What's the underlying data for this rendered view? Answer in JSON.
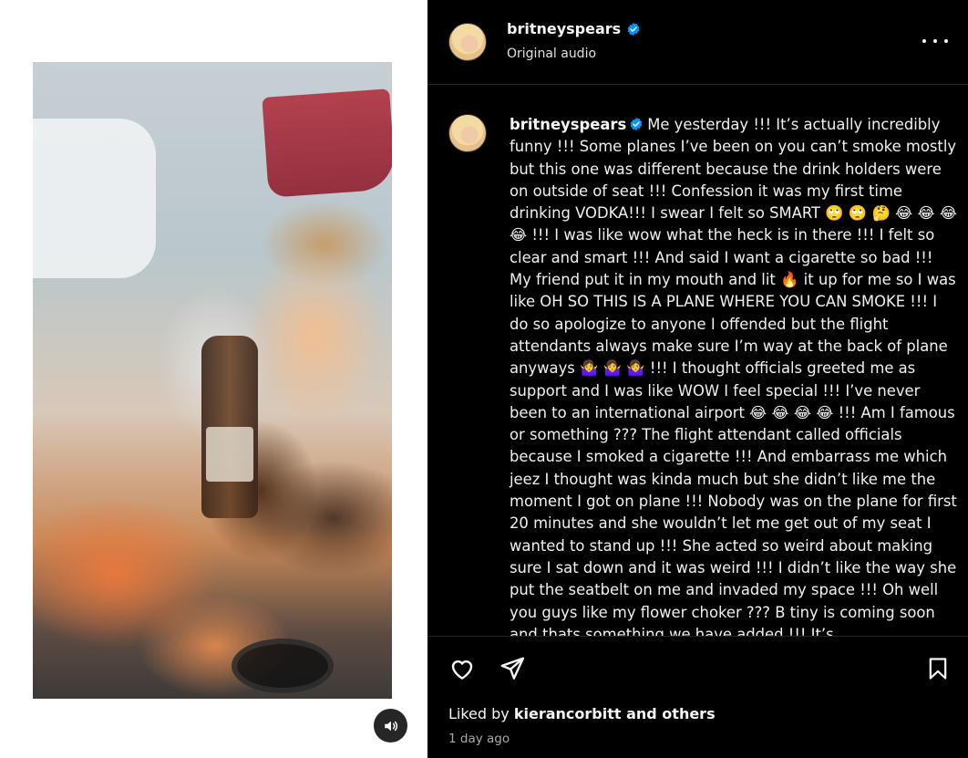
{
  "post": {
    "username": "britneyspears",
    "audio": "Original audio",
    "caption": "Me yesterday !!! It’s actually incredibly funny !!! Some planes I’ve been on you can’t smoke mostly but this one was different because the drink holders were on outside of seat !!! Confession it was my first time drinking VODKA!!! I swear I felt so SMART 🙄 🙄 🤔 😂 😂 😂 😂 !!! I was like wow what the heck is in there !!! I felt so clear and smart !!! And said I want a cigarette so bad !!! My friend put it in my mouth and lit 🔥 it up for me so I was like OH SO THIS IS A PLANE WHERE YOU CAN SMOKE !!! I do so apologize to anyone I offended but the flight attendants always make sure I’m way at the back of plane anyways 🤷‍♀️ 🤷‍♀️ 🤷‍♀️ !!! I thought officials greeted me as support and I was like WOW I feel special !!! I’ve never been to an international airport 😂 😂 😂 😂 !!! Am I famous or something ??? The flight attendant called officials because I smoked a cigarette !!! And embarrass me which jeez I thought was kinda much but she didn’t like me the moment I got on plane !!! Nobody was on the plane for first 20 minutes and she wouldn’t let me get out of my seat I wanted to stand up !!! She acted so weird about making sure I sat down and it was weird !!! I didn’t like the way she put the seatbelt on me and invaded my space !!! Oh well you guys like my flower choker ??? B tiny is coming soon and thats something we have added !!! It’s",
    "liked_by_prefix": "Liked by ",
    "liked_by_user": "kierancorbitt",
    "liked_by_suffix": " and others",
    "timestamp": "1 day ago"
  },
  "icons": {
    "verified": "verified-badge-icon",
    "more": "more-options-icon",
    "like": "heart-icon",
    "share": "paper-plane-icon",
    "save": "bookmark-icon",
    "sound": "speaker-icon"
  },
  "colors": {
    "verified": "#0095f6",
    "background": "#000000",
    "muted": "#a8a8a8"
  }
}
